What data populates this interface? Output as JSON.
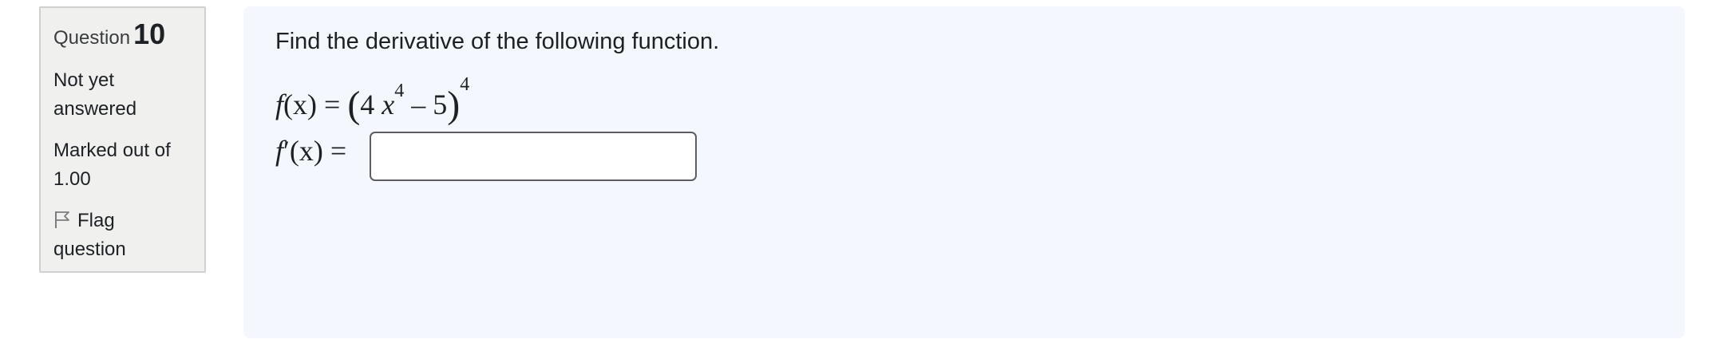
{
  "question_info": {
    "heading_label": "Question",
    "number": "10",
    "state_line1": "Not yet",
    "state_line2": "answered",
    "grade_line1": "Marked out of",
    "grade_line2": "1.00",
    "flag_line1": "Flag",
    "flag_line2": "question",
    "flag_icon": "flag-outline-icon"
  },
  "question": {
    "prompt": "Find the derivative of the following function.",
    "function": {
      "lhs_f": "f",
      "lhs_arg": "(x)",
      "equals": "=",
      "open_paren": "(",
      "coef": "4",
      "var": "x",
      "inner_power": "4",
      "minus": "–",
      "constant": "5",
      "close_paren": ")",
      "outer_power": "4"
    },
    "derivative": {
      "label_f": "f",
      "prime": "′",
      "label_arg": "(x)",
      "equals": "=",
      "answer_value": "",
      "answer_placeholder": ""
    }
  },
  "colors": {
    "info_box_bg": "#f0f0ee",
    "content_bg": "#f4f7fd",
    "text": "#1d2125"
  }
}
